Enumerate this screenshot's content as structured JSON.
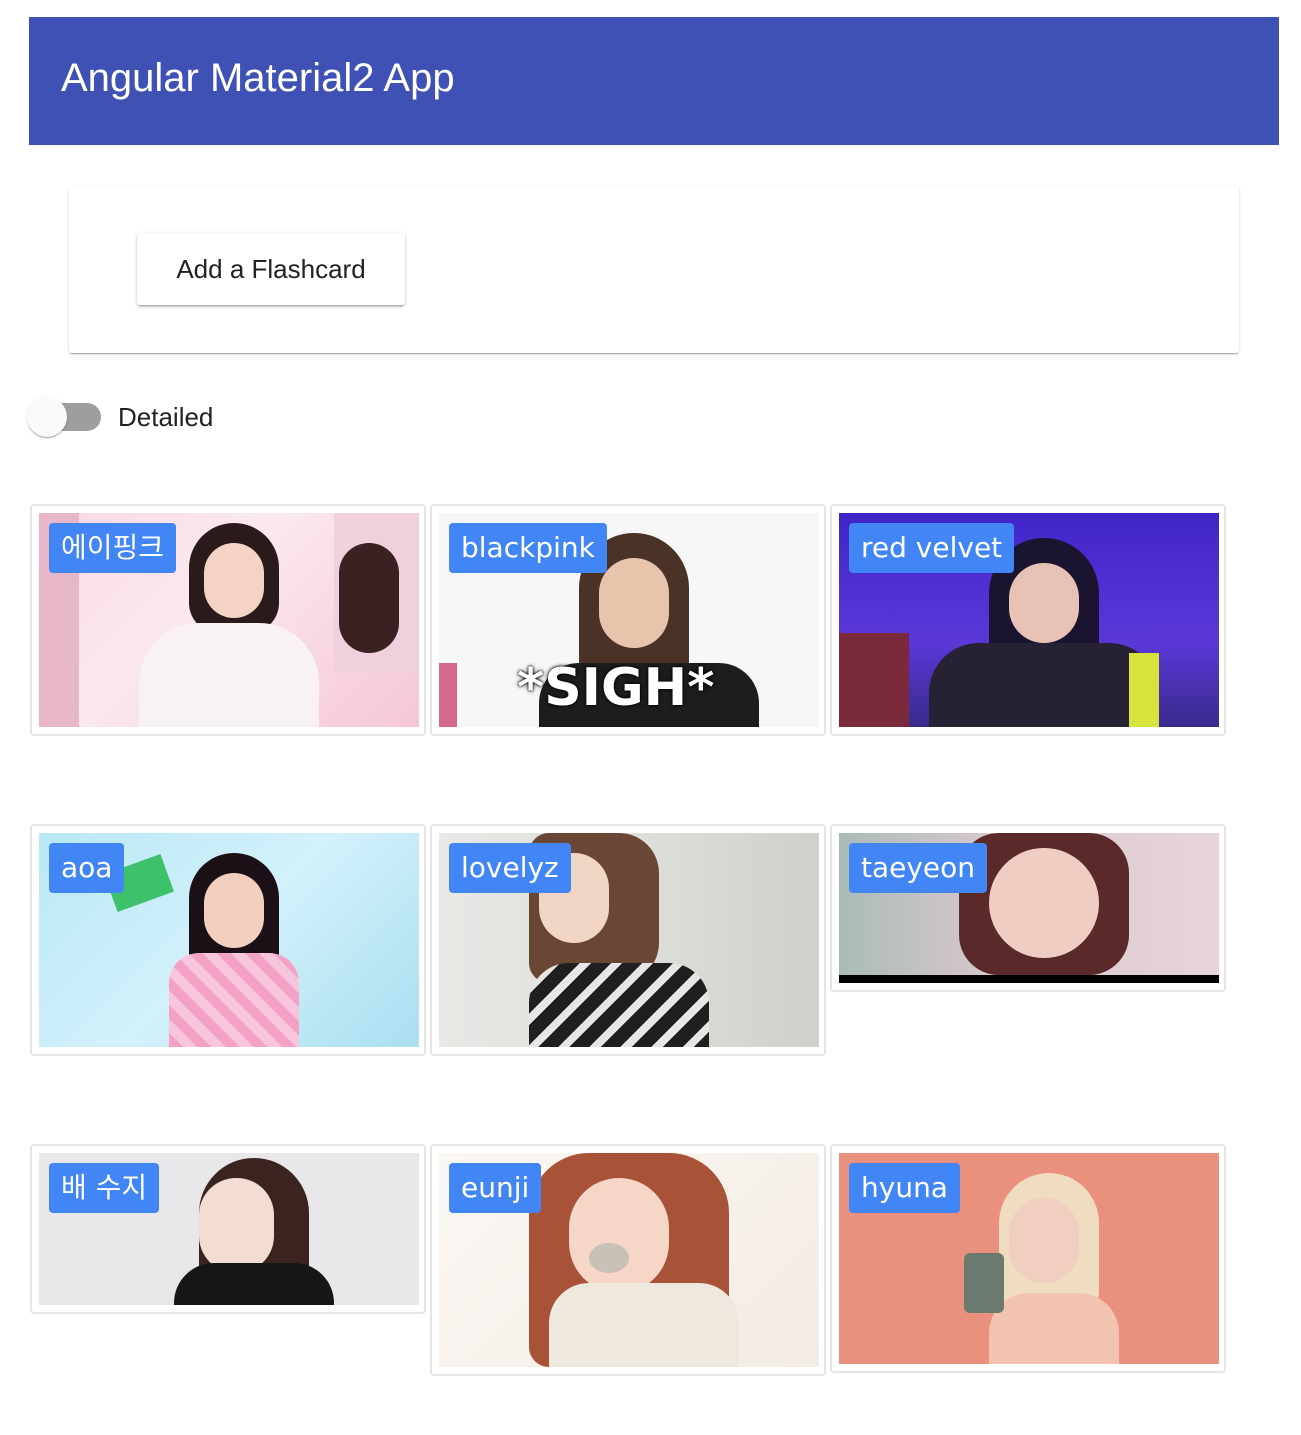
{
  "app": {
    "title": "Angular Material2 App"
  },
  "card": {
    "add_label": "Add a Flashcard"
  },
  "toggle": {
    "label": "Detailed",
    "checked": false
  },
  "tiles": [
    {
      "label": "에이핑크"
    },
    {
      "label": "blackpink",
      "caption": "*SIGH*"
    },
    {
      "label": "red velvet"
    },
    {
      "label": "aoa"
    },
    {
      "label": "lovelyz"
    },
    {
      "label": "taeyeon"
    },
    {
      "label": "배 수지"
    },
    {
      "label": "eunji"
    },
    {
      "label": "hyuna"
    }
  ],
  "colors": {
    "toolbar": "#3f51b5",
    "badge": "#4285f4"
  }
}
